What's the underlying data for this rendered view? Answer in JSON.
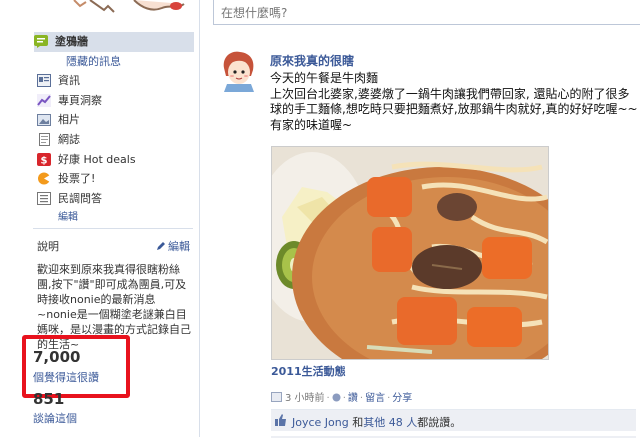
{
  "sidebar": {
    "nav": [
      {
        "label": "塗鴉牆",
        "active": true,
        "icon": "wall-icon"
      },
      {
        "label": "隱藏的訊息",
        "sub": true
      },
      {
        "label": "資訊",
        "icon": "info-icon"
      },
      {
        "label": "專頁洞察",
        "icon": "insights-icon"
      },
      {
        "label": "相片",
        "icon": "photos-icon"
      },
      {
        "label": "網誌",
        "icon": "notes-icon"
      },
      {
        "label": "好康 Hot deals",
        "icon": "deals-icon"
      },
      {
        "label": "投票了!",
        "icon": "poll-icon"
      },
      {
        "label": "民調問答",
        "icon": "questions-icon"
      },
      {
        "label": "編輯",
        "edit": true
      }
    ],
    "intro_title": "說明",
    "intro_edit": "編輯",
    "intro_text": "歡迎來到原來我真得很瞎粉絲團,按下\"讚\"即可成為團員,可及時接收nonie的最新消息~nonie是一個糊塗老謎兼白目媽咪，是以漫畫的方式記錄自己的生活~",
    "likes_count": "7,000",
    "likes_label": "個覺得這很讚",
    "talking_count": "851",
    "talking_label": "談論這個"
  },
  "composer": {
    "placeholder": "在想什麼嗎?"
  },
  "post": {
    "author": "原來我真的很瞎",
    "text": "今天的午餐是牛肉麵\n上次回台北婆家,婆婆燉了一鍋牛肉讓我們帶回家, 還貼心的附了很多球的手工麵條,想吃時只要把麵煮好,放那鍋牛肉就好,真的好好吃喔~~有家的味道喔~",
    "album": "2011生活動態",
    "time": "3 小時前",
    "like_action": "讚",
    "comment_action": "留言",
    "share_action": "分享",
    "likers": "Joyce Jong",
    "and_word": " 和",
    "others": "其他 48 人",
    "likes_suffix": "都說讚。"
  },
  "colors": {
    "link": "#3b5998",
    "highlight_box": "#e8121d",
    "nav_active_bg": "#d8dfea"
  }
}
